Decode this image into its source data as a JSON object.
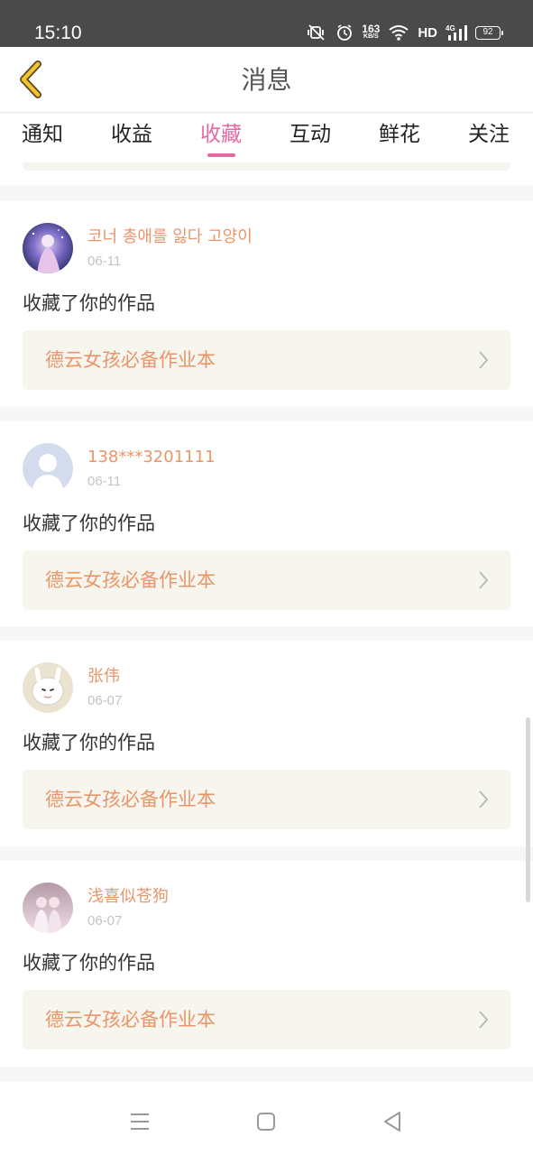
{
  "status": {
    "time": "15:10",
    "net_speed": "163",
    "net_unit": "KB/S",
    "hd": "HD",
    "network": "4G",
    "battery": "92"
  },
  "header": {
    "title": "消息"
  },
  "tabs": [
    {
      "label": "通知",
      "active": false
    },
    {
      "label": "收益",
      "active": false
    },
    {
      "label": "收藏",
      "active": true
    },
    {
      "label": "互动",
      "active": false
    },
    {
      "label": "鲜花",
      "active": false
    },
    {
      "label": "关注",
      "active": false
    }
  ],
  "items": [
    {
      "username": "코너 총애를 잃다 고양이",
      "date": "06-11",
      "action": "收藏了你的作品",
      "work": "德云女孩必备作业本"
    },
    {
      "username": "138***3201111",
      "date": "06-11",
      "action": "收藏了你的作品",
      "work": "德云女孩必备作业本"
    },
    {
      "username": "张伟",
      "date": "06-07",
      "action": "收藏了你的作品",
      "work": "德云女孩必备作业本"
    },
    {
      "username": "浅喜似苍狗",
      "date": "06-07",
      "action": "收藏了你的作品",
      "work": "德云女孩必备作业本"
    }
  ],
  "colors": {
    "accent": "#e56aa4",
    "name": "#e8966a",
    "card_bg": "#f6f5ee",
    "back_arrow": "#f2c230"
  }
}
